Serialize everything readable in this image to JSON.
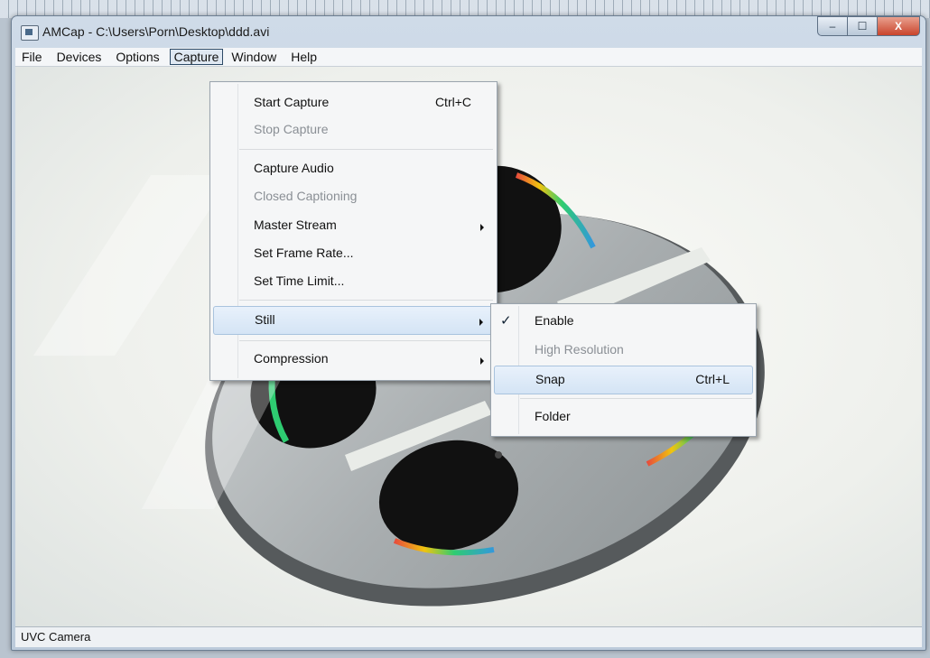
{
  "window": {
    "title": "AMCap - C:\\Users\\Porn\\Desktop\\ddd.avi",
    "minimize": "–",
    "maximize": "☐",
    "close": "X"
  },
  "menubar": {
    "items": [
      "File",
      "Devices",
      "Options",
      "Capture",
      "Window",
      "Help"
    ]
  },
  "capture_menu": {
    "items": [
      {
        "label": "Start Capture",
        "shortcut": "Ctrl+C"
      },
      {
        "label": "Stop Capture"
      },
      {
        "label": "Capture Audio"
      },
      {
        "label": "Closed Captioning"
      },
      {
        "label": "Master Stream"
      },
      {
        "label": "Set Frame Rate..."
      },
      {
        "label": "Set Time Limit..."
      },
      {
        "label": "Still"
      },
      {
        "label": "Compression"
      }
    ]
  },
  "still_menu": {
    "items": [
      {
        "label": "Enable",
        "check": "✓"
      },
      {
        "label": "High Resolution"
      },
      {
        "label": "Snap",
        "shortcut": "Ctrl+L"
      },
      {
        "label": "Folder"
      }
    ]
  },
  "statusbar": {
    "text": "UVC Camera"
  },
  "colors": {
    "highlight": "#d4e4f5",
    "disabled_text": "#8a8f95",
    "close_button": "#c9442c"
  }
}
